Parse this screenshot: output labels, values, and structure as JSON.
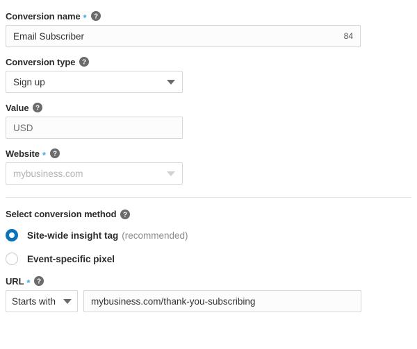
{
  "form": {
    "conversion_name": {
      "label": "Conversion name",
      "required_marker": "*",
      "help_icon": "help-circle-icon",
      "value": "Email Subscriber",
      "char_count": "84"
    },
    "conversion_type": {
      "label": "Conversion type",
      "help_icon": "help-circle-icon",
      "selected": "Sign up",
      "caret_icon": "chevron-down-icon"
    },
    "value_field": {
      "label": "Value",
      "help_icon": "help-circle-icon",
      "placeholder": "USD",
      "value": "USD"
    },
    "website": {
      "label": "Website",
      "required_marker": "*",
      "help_icon": "help-circle-icon",
      "placeholder": "mybusiness.com",
      "caret_icon": "chevron-down-icon"
    },
    "conversion_method": {
      "label": "Select conversion method",
      "help_icon": "help-circle-icon",
      "options": [
        {
          "label": "Site-wide insight tag",
          "hint": "(recommended)",
          "selected": true
        },
        {
          "label": "Event-specific pixel",
          "hint": "",
          "selected": false
        }
      ]
    },
    "url": {
      "label": "URL",
      "required_marker": "*",
      "help_icon": "help-circle-icon",
      "match_type": "Starts with",
      "caret_icon": "chevron-down-icon",
      "value": "mybusiness.com/thank-you-subscribing"
    }
  },
  "colors": {
    "accent_blue": "#0b73b8",
    "required_marker": "#4aa8e0",
    "help_icon_bg": "#6b6b6b",
    "border": "#d6d6d6",
    "text": "#2b2b2b",
    "muted_text": "#8a8a8a"
  }
}
